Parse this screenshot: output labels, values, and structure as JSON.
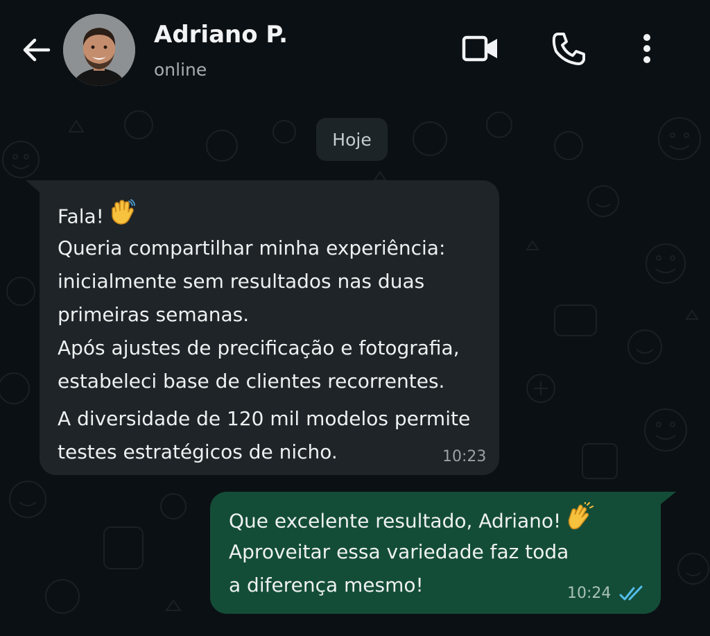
{
  "header": {
    "contact_name": "Adriano P.",
    "status": "online",
    "icons": [
      "back-arrow-icon",
      "avatar",
      "video-call-icon",
      "phone-icon",
      "more-vertical-icon"
    ]
  },
  "date_chip": "Hoje",
  "messages": [
    {
      "direction": "incoming",
      "lines": [
        "Fala!",
        "Queria compartilhar minha experiência:",
        "inicialmente sem resultados nas duas",
        "primeiras semanas.",
        "Após ajustes de precificação e fotografia,",
        "estabeleci base de clientes recorrentes.",
        "A diversidade de 120 mil modelos permite",
        "testes estratégicos de nicho."
      ],
      "emoji": "waving-hand-emoji",
      "time": "10:23"
    },
    {
      "direction": "outgoing",
      "lines": [
        "Que excelente resultado, Adriano!",
        "Aproveitar essa variedade faz toda",
        "a diferença mesmo!"
      ],
      "emoji": "clapping-hands-emoji",
      "time": "10:24",
      "read_status": "read-double-check-icon"
    }
  ],
  "colors": {
    "background": "#0b1014",
    "incoming_bubble": "#1f2428",
    "outgoing_bubble": "#144d37",
    "read_ticks": "#53bdeb"
  }
}
